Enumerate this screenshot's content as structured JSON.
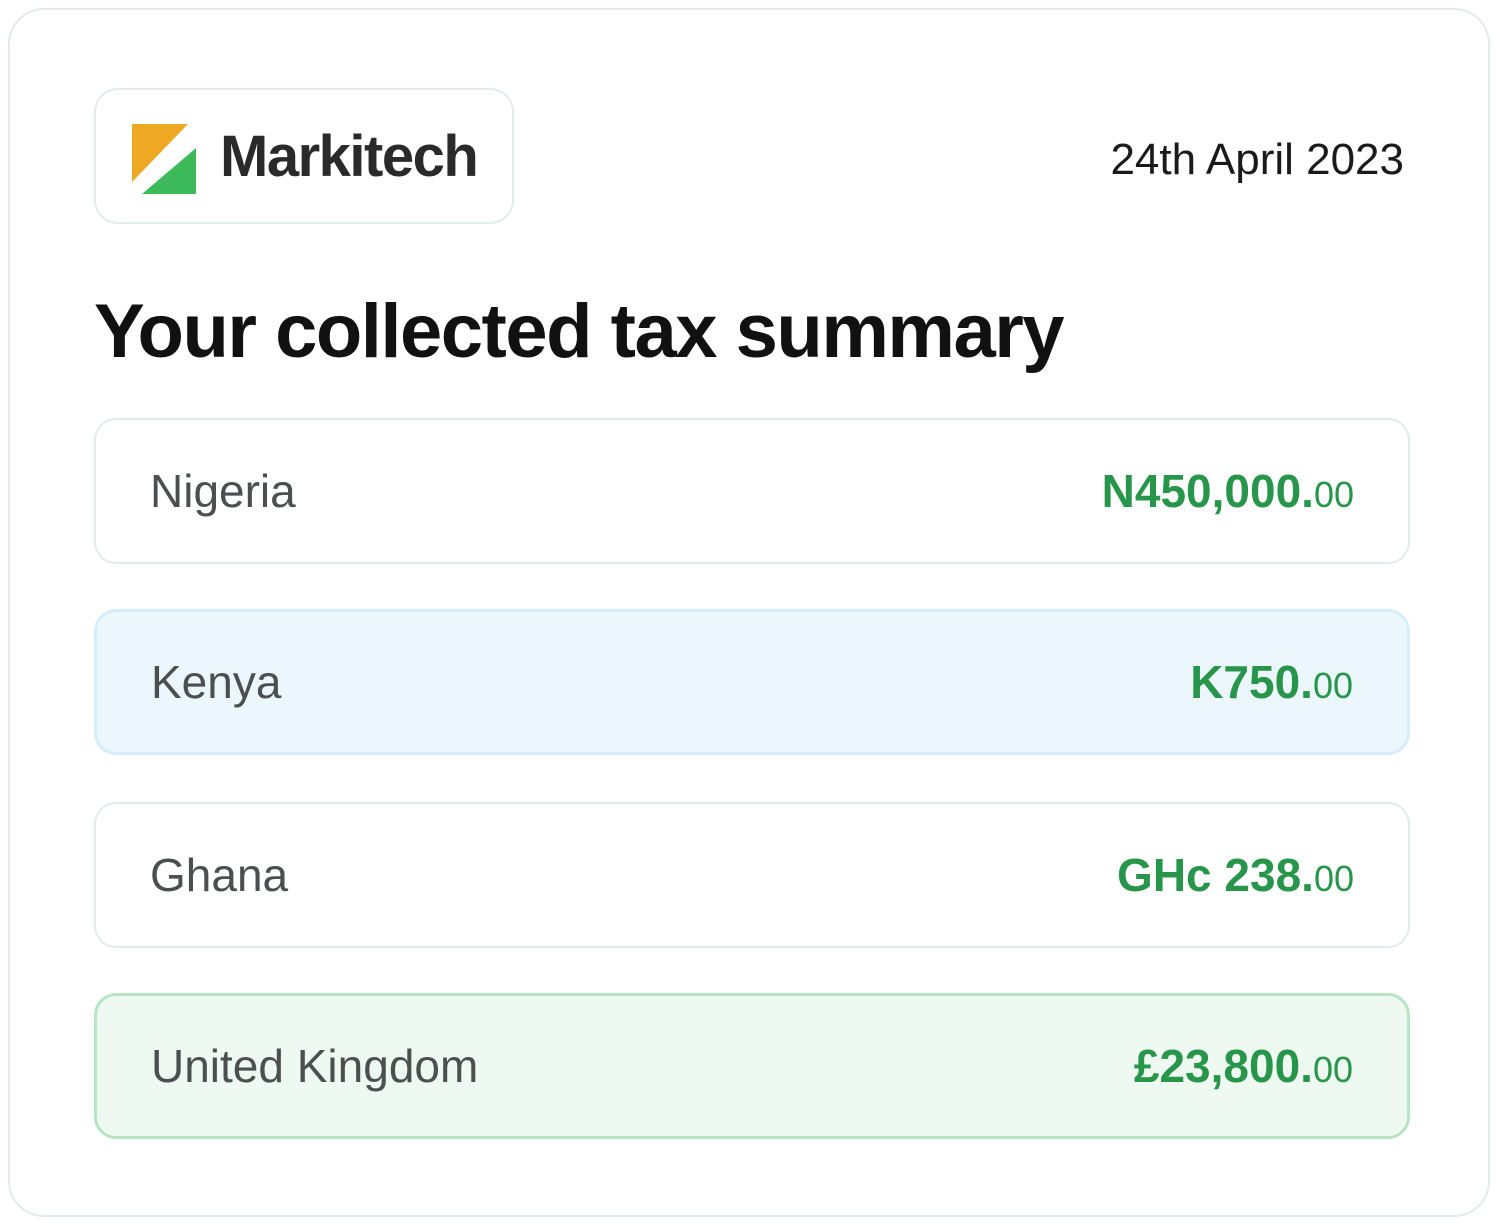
{
  "header": {
    "brand": "Markitech",
    "logo_icon": "markitech-logo-icon",
    "date": "24th April 2023"
  },
  "title": "Your collected tax summary",
  "rows": [
    {
      "country": "Nigeria",
      "amount_main": "N450,000.",
      "amount_decimal": "00",
      "highlight": "none"
    },
    {
      "country": "Kenya",
      "amount_main": "K750.",
      "amount_decimal": "00",
      "highlight": "blue"
    },
    {
      "country": "Ghana",
      "amount_main": "GHc 238.",
      "amount_decimal": "00",
      "highlight": "none"
    },
    {
      "country": "United Kingdom",
      "amount_main": "£23,800.",
      "amount_decimal": "00",
      "highlight": "green"
    }
  ],
  "colors": {
    "accent_green": "#27964a",
    "logo_orange": "#eea823",
    "logo_green": "#3cba5a",
    "blue_row_bg": "#ecf7fd",
    "green_row_bg": "#eef9f1"
  }
}
